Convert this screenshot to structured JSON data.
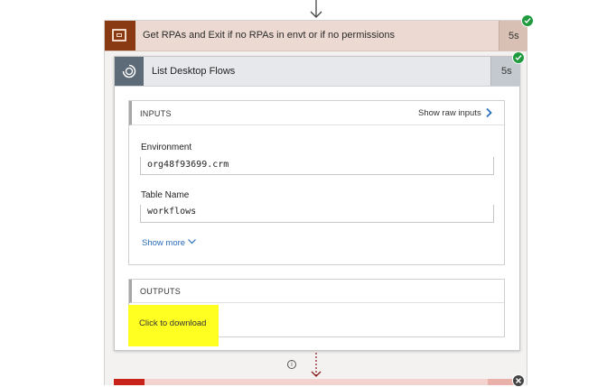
{
  "scope": {
    "title": "Get RPAs and Exit if no RPAs in envt or if no permissions",
    "duration": "5s"
  },
  "action": {
    "title": "List Desktop Flows",
    "duration": "5s"
  },
  "inputs": {
    "heading": "INPUTS",
    "show_raw_label": "Show raw inputs",
    "fields": [
      {
        "label": "Environment",
        "value": "org48f93699.crm"
      },
      {
        "label": "Table Name",
        "value": "workflows"
      }
    ],
    "show_more_label": "Show more"
  },
  "outputs": {
    "heading": "OUTPUTS",
    "download_label": "Click to download"
  },
  "connector": {
    "info_glyph": "i"
  },
  "colors": {
    "scope_icon_bg": "#8a3a12",
    "scope_header_bg": "#ecd9d1",
    "success": "#1f9a3e",
    "highlight": "#ffff22",
    "link": "#2a6ebb",
    "error_red": "#c8231b"
  }
}
